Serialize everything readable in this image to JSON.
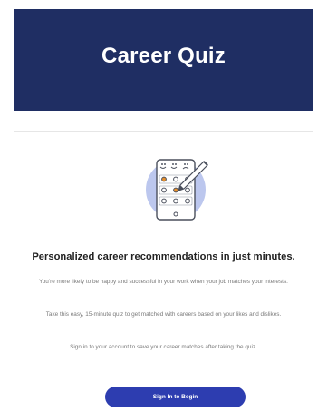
{
  "header": {
    "title": "Career Quiz"
  },
  "content": {
    "headline": "Personalized career recommendations in just minutes.",
    "paragraphs": [
      "You're more likely to be happy and successful in your work when your job matches your interests.",
      "Take this easy, 15-minute quiz to get matched with careers based on your likes and dislikes.",
      "Sign in to your account to save your career matches after taking the quiz."
    ]
  },
  "cta": {
    "label": "Sign In to Begin"
  },
  "icons": {
    "illustration": "quiz-tablet-icon"
  },
  "colors": {
    "header_bg": "#1f2e63",
    "button_bg": "#2d3db0",
    "illustration_circle": "#bcc7ee",
    "accent_orange": "#e8912d"
  }
}
